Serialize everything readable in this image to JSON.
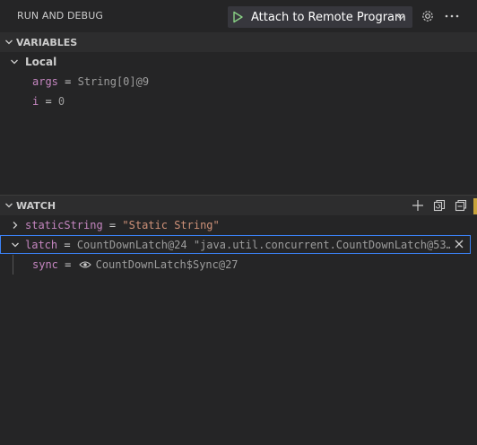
{
  "header": {
    "title": "RUN AND DEBUG",
    "launch_config": "Attach to Remote Program",
    "icons": {
      "start": "play-icon",
      "dropdown": "chevron-down-icon",
      "settings": "gear-icon",
      "more": "ellipsis-icon"
    },
    "colors": {
      "play": "#89d185",
      "bg": "#252526"
    }
  },
  "variables": {
    "title": "VARIABLES",
    "scope": "Local",
    "items": [
      {
        "name": "args",
        "eq": " = ",
        "value": "String[0]@9"
      },
      {
        "name": "i",
        "eq": " = ",
        "value": "0"
      }
    ]
  },
  "watch": {
    "title": "WATCH",
    "actions": [
      "add-expression-icon",
      "refresh-icon",
      "collapse-all-icon"
    ],
    "items": [
      {
        "name": "staticString",
        "eq": " = ",
        "value": "\"Static String\""
      },
      {
        "name": "latch",
        "eq": " = ",
        "value": "CountDownLatch@24 \"java.util.concurrent.CountDownLatch@53…"
      }
    ],
    "child": {
      "name": "sync",
      "eq": " = ",
      "value": "CountDownLatch$Sync@27"
    }
  }
}
